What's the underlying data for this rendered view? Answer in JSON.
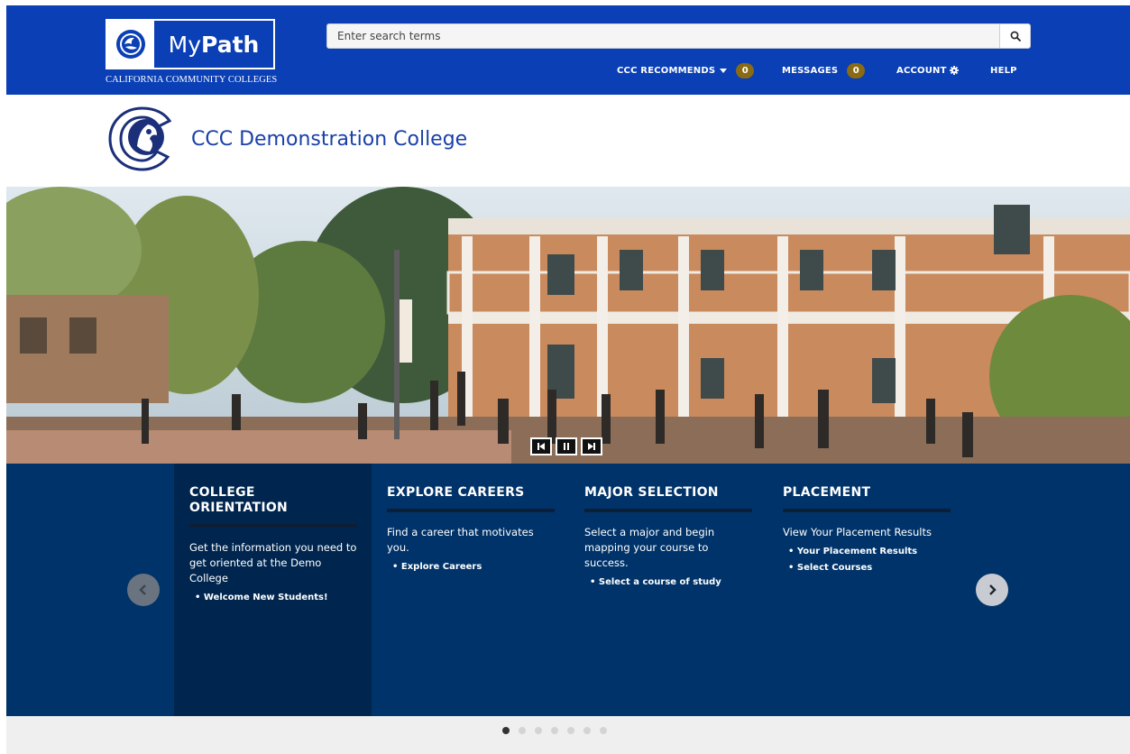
{
  "header": {
    "logo_my": "My",
    "logo_path": "Path",
    "logo_subtitle": "CALIFORNIA COMMUNITY COLLEGES",
    "search_placeholder": "Enter search terms",
    "search_icon": "search-icon",
    "nav": {
      "recommends_label": "CCC RECOMMENDS",
      "recommends_count": "0",
      "messages_label": "MESSAGES",
      "messages_count": "0",
      "account_label": "ACCOUNT",
      "account_icon": "gear-icon",
      "help_label": "HELP"
    },
    "colors": {
      "header_bg": "#0a3fb5",
      "badge": "#8a6a12"
    }
  },
  "college": {
    "name": "CCC Demonstration College"
  },
  "hero": {
    "controls": [
      "previous-slide",
      "pause",
      "next-slide"
    ]
  },
  "cards": [
    {
      "title": "COLLEGE ORIENTATION",
      "description": "Get the information you need to get oriented at the Demo College",
      "links": [
        "Welcome New Students!"
      ]
    },
    {
      "title": "EXPLORE CAREERS",
      "description": "Find a career that motivates you.",
      "links": [
        "Explore Careers"
      ]
    },
    {
      "title": "MAJOR SELECTION",
      "description": "Select a major and begin mapping your course to success.",
      "links": [
        "Select a course of study"
      ]
    },
    {
      "title": "PLACEMENT",
      "description": "View Your Placement Results",
      "links": [
        "Your Placement Results",
        "Select Courses"
      ]
    }
  ],
  "carousel": {
    "page_count": 7,
    "active_page": 1,
    "colors": {
      "panel_bg": "#003369",
      "active_card_bg": "#00264f"
    }
  }
}
